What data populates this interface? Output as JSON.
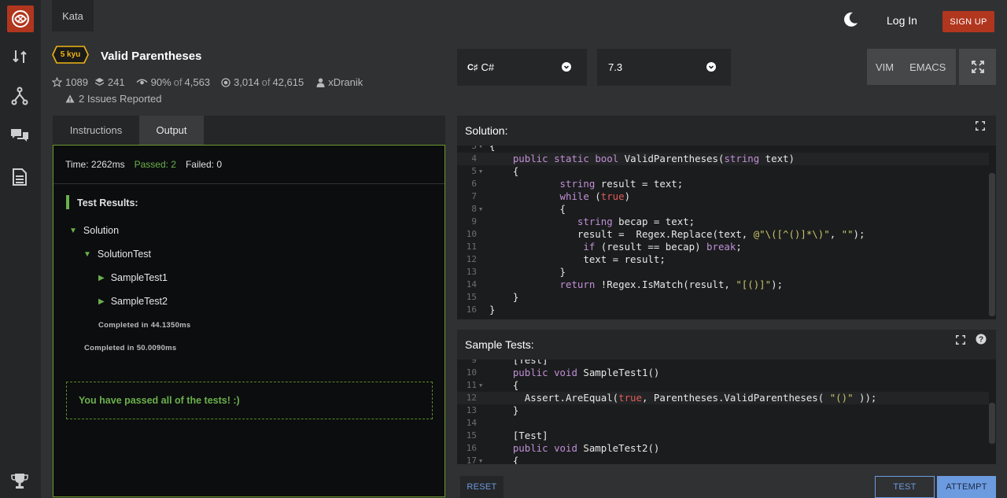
{
  "nav": {
    "kata_tab": "Kata",
    "login": "Log In",
    "signup": "SIGN UP"
  },
  "sidebar": {
    "icons": [
      "codewars-logo",
      "practice-icon",
      "fork-icon",
      "discuss-icon",
      "docs-icon",
      "trophy-icon"
    ]
  },
  "kata": {
    "rank": "5 kyu",
    "title": "Valid Parentheses",
    "stars": "1089",
    "collections": "241",
    "satisfaction": "90%",
    "satisfaction_of": "of",
    "satisfaction_total": "4,563",
    "completed": "3,014",
    "completed_of": "of",
    "completed_total": "42,615",
    "author": "xDranik",
    "issues": "2 Issues Reported"
  },
  "language": {
    "selected": "C#",
    "version": "7.3"
  },
  "editor_modes": {
    "vim": "VIM",
    "emacs": "EMACS"
  },
  "left_tabs": {
    "instructions": "Instructions",
    "output": "Output"
  },
  "output": {
    "time": "Time: 2262ms",
    "passed": "Passed: 2",
    "failed": "Failed: 0",
    "test_results": "Test Results:",
    "solution": "Solution",
    "solution_test": "SolutionTest",
    "sample1": "SampleTest1",
    "sample2": "SampleTest2",
    "completed_inner": "Completed in 44.1350ms",
    "completed_outer": "Completed in 50.0090ms",
    "passed_msg": "You have passed all of the tests! :)"
  },
  "solution_panel": {
    "title": "Solution:"
  },
  "sample_panel": {
    "title": "Sample Tests:"
  },
  "solution_code": [
    {
      "n": "3",
      "fold": true,
      "text": "{"
    },
    {
      "n": "4",
      "fold": false,
      "text": "    public static bool ValidParentheses(string text)"
    },
    {
      "n": "5",
      "fold": true,
      "text": "    {"
    },
    {
      "n": "6",
      "fold": false,
      "text": "            string result = text;"
    },
    {
      "n": "7",
      "fold": false,
      "text": "            while (true)"
    },
    {
      "n": "8",
      "fold": true,
      "text": "            {"
    },
    {
      "n": "9",
      "fold": false,
      "text": "               string becap = text;"
    },
    {
      "n": "10",
      "fold": false,
      "text": "               result =  Regex.Replace(text, @\"\\([^()]*\\)\", \"\");"
    },
    {
      "n": "11",
      "fold": false,
      "text": "                if (result == becap) break;"
    },
    {
      "n": "12",
      "fold": false,
      "text": "                text = result;"
    },
    {
      "n": "13",
      "fold": false,
      "text": "            }"
    },
    {
      "n": "14",
      "fold": false,
      "text": "            return !Regex.IsMatch(result, \"[()]\");"
    },
    {
      "n": "15",
      "fold": false,
      "text": "    }"
    },
    {
      "n": "16",
      "fold": false,
      "text": "}"
    }
  ],
  "sample_code": [
    {
      "n": "9",
      "fold": false,
      "text": "    [Test]"
    },
    {
      "n": "10",
      "fold": false,
      "text": "    public void SampleTest1()"
    },
    {
      "n": "11",
      "fold": true,
      "text": "    {"
    },
    {
      "n": "12",
      "fold": false,
      "text": "      Assert.AreEqual(true, Parentheses.ValidParentheses( \"()\" ));"
    },
    {
      "n": "13",
      "fold": false,
      "text": "    }"
    },
    {
      "n": "14",
      "fold": false,
      "text": ""
    },
    {
      "n": "15",
      "fold": false,
      "text": "    [Test]"
    },
    {
      "n": "16",
      "fold": false,
      "text": "    public void SampleTest2()"
    },
    {
      "n": "17",
      "fold": true,
      "text": "    {"
    }
  ],
  "buttons": {
    "reset": "RESET",
    "test": "TEST",
    "attempt": "ATTEMPT"
  },
  "colors": {
    "brand": "#b1361e",
    "pass": "#6ab04c",
    "rank": "#ecb613",
    "attempt": "#6d9be0"
  }
}
